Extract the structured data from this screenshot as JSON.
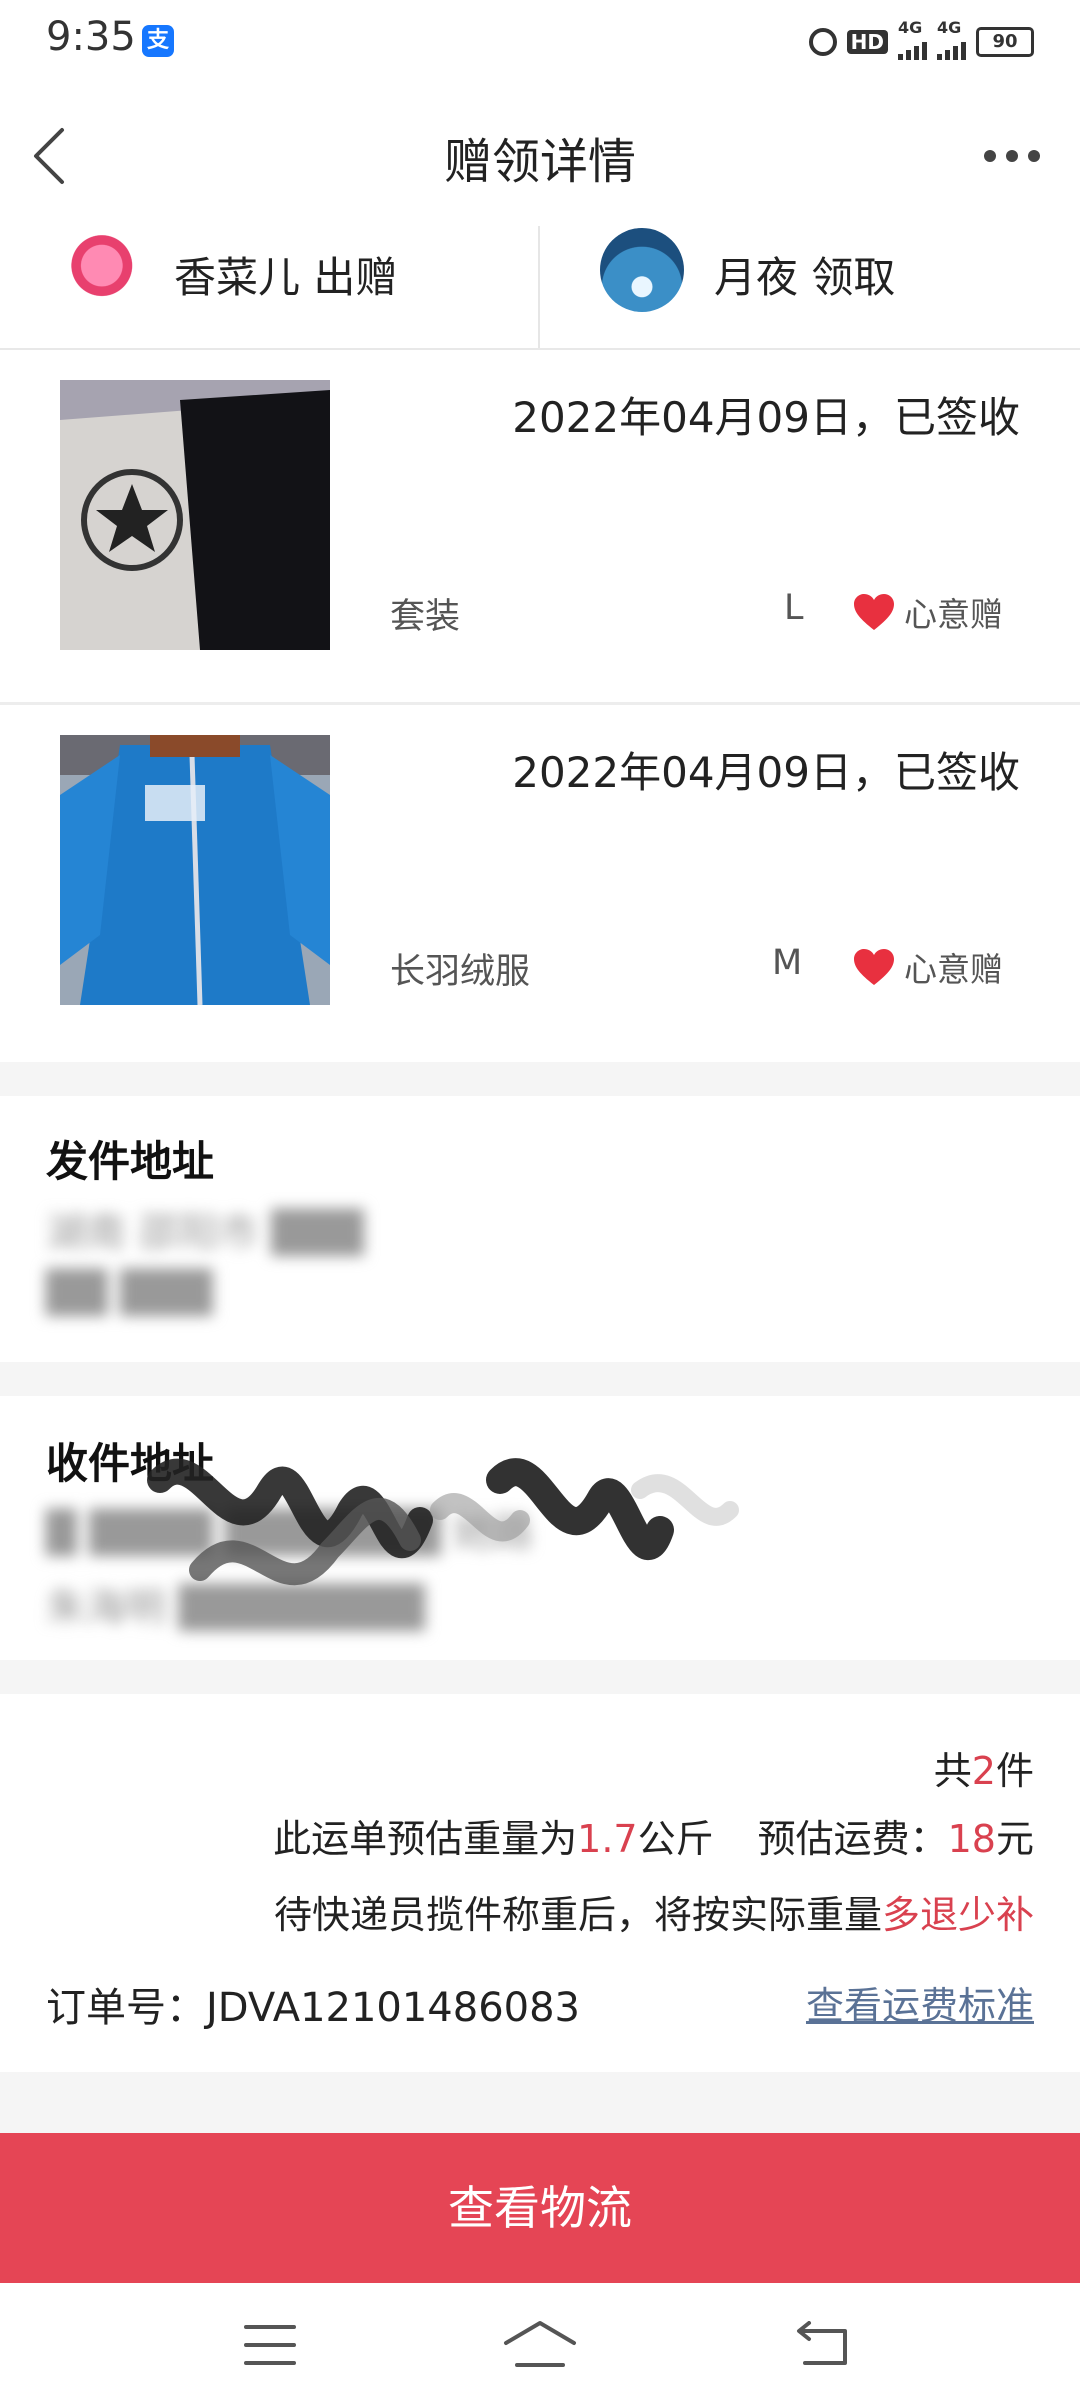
{
  "status_bar": {
    "time": "9:35",
    "alipay_icon_glyph": "支",
    "hd_label": "HD",
    "signal1_label": "4G",
    "signal2_label": "4G",
    "battery": "90"
  },
  "header": {
    "title": "赠领详情"
  },
  "parties": {
    "giver": "香菜儿 出赠",
    "receiver": "月夜 领取"
  },
  "items": [
    {
      "date_status": "2022年04月09日，已签收",
      "name": "套装",
      "size": "L",
      "tag": "心意赠"
    },
    {
      "date_status": "2022年04月09日，已签收",
      "name": "长羽绒服",
      "size": "M",
      "tag": "心意赠"
    }
  ],
  "sender_section": {
    "title": "发件地址",
    "line1": "湖南 邵阳市 ███",
    "line2": "██ ███"
  },
  "receiver_section": {
    "title": "收件地址",
    "line1": "█ ████ ███████ 她路",
    "line2": "朱海明 ████████"
  },
  "summary": {
    "count_prefix": "共",
    "count": "2",
    "count_suffix": "件",
    "weight_prefix": "此运单预估重量为",
    "weight": "1.7",
    "weight_unit": "公斤",
    "fee_prefix": "预估运费：",
    "fee": "18",
    "fee_unit": "元",
    "note_prefix": "待快递员揽件称重后，将按实际重量",
    "note_highlight": "多退少补",
    "order_label": "订单号：",
    "order_number": "JDVA12101486083",
    "fee_standard_link": "查看运费标准"
  },
  "track_button": "查看物流",
  "colors": {
    "accent": "#e54555",
    "highlight_text": "#d9414f",
    "link": "#5a7296",
    "heart": "#e8303f"
  },
  "icons": [
    "back-icon",
    "more-icon",
    "heart-icon",
    "menu-icon",
    "home-icon",
    "back-nav-icon"
  ]
}
